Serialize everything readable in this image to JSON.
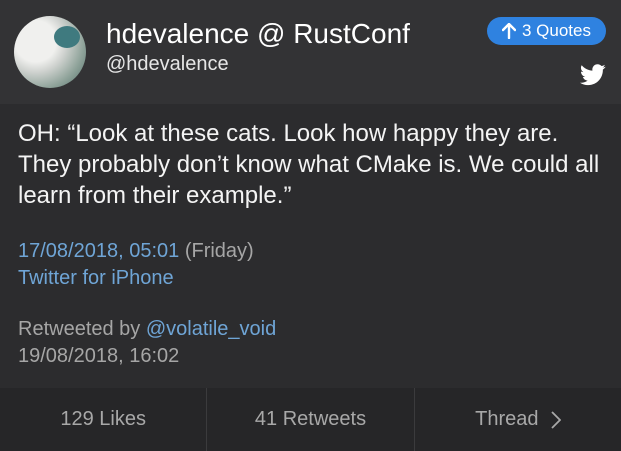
{
  "header": {
    "display_name": "hdevalence @ RustConf",
    "handle": "@hdevalence",
    "quotes_label": "3 Quotes",
    "avatar_icon": "avatar-dog-photo",
    "bird_icon": "twitter-bird-icon",
    "accent_color": "#2f82e0"
  },
  "tweet": {
    "text": "OH: “Look at these cats. Look how happy they are. They probably don’t know what CMake is. We could all learn from their example.”",
    "date": "17/08/2018, 05:01",
    "weekday": "(Friday)",
    "source": "Twitter for iPhone",
    "retweeted_by_label": "Retweeted by",
    "retweeted_by_user": "@volatile_void",
    "retweet_date": "19/08/2018, 16:02"
  },
  "footer": {
    "likes": "129 Likes",
    "retweets": "41 Retweets",
    "thread": "Thread"
  }
}
